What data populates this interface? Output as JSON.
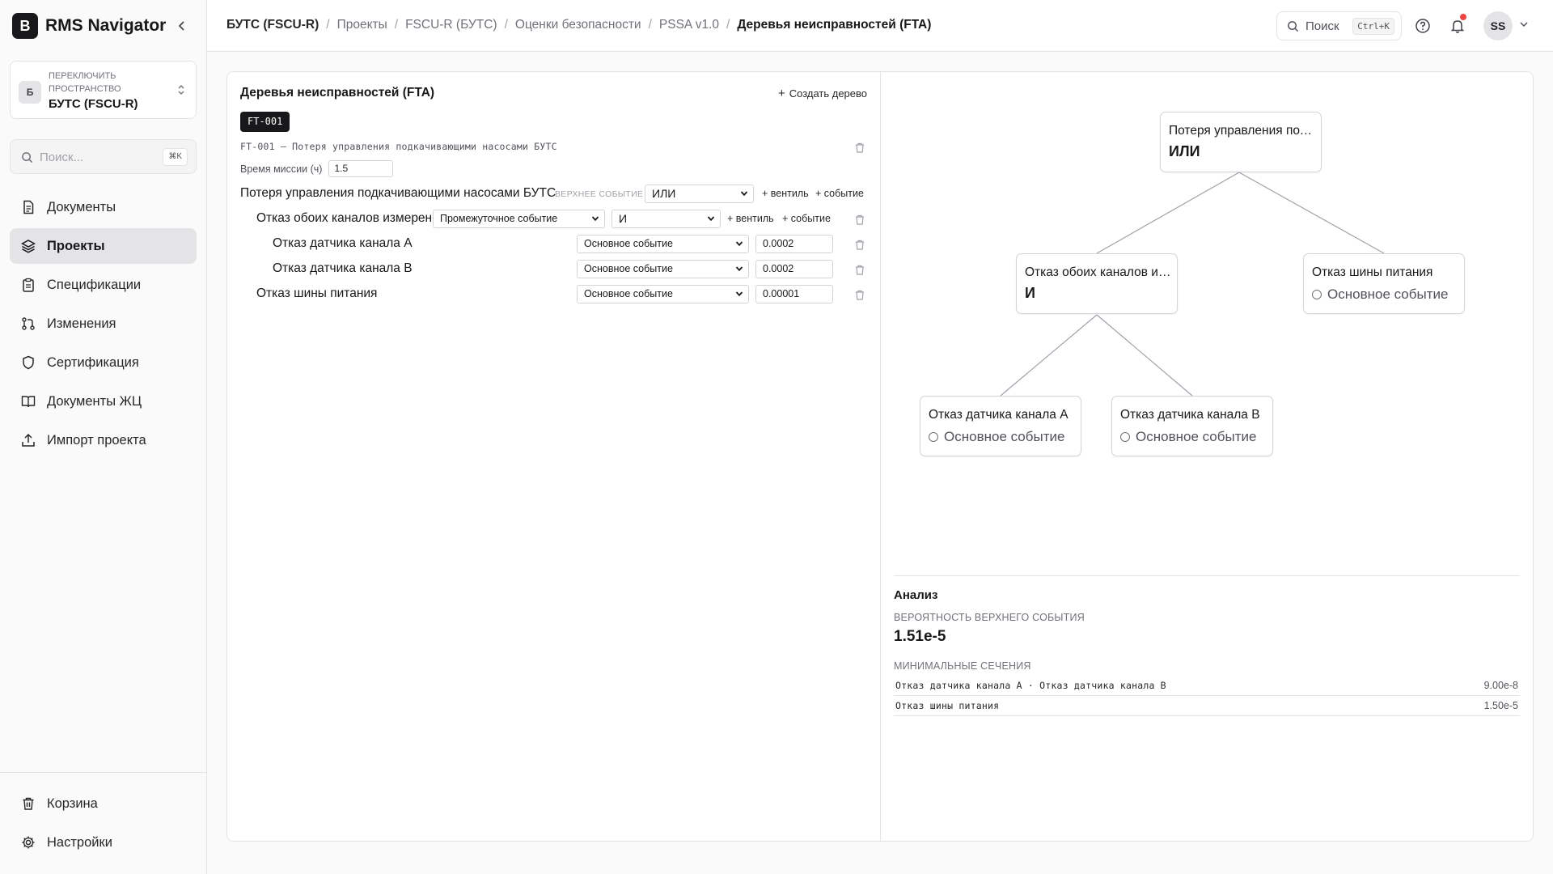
{
  "app": {
    "logo_letter": "B",
    "name": "RMS Navigator"
  },
  "workspace": {
    "switch_label": "Переключить пространство",
    "avatar_letter": "Б",
    "name": "БУТС (FSCU-R)"
  },
  "sidebar_search": {
    "placeholder": "Поиск...",
    "shortcut": "⌘K"
  },
  "nav": {
    "items": [
      {
        "label": "Документы",
        "icon": "file-text-icon"
      },
      {
        "label": "Проекты",
        "icon": "layers-icon",
        "active": true
      },
      {
        "label": "Спецификации",
        "icon": "clipboard-list-icon"
      },
      {
        "label": "Изменения",
        "icon": "git-pull-request-icon"
      },
      {
        "label": "Сертификация",
        "icon": "shield-icon"
      },
      {
        "label": "Документы ЖЦ",
        "icon": "book-open-icon"
      },
      {
        "label": "Импорт проекта",
        "icon": "upload-icon"
      }
    ],
    "bottom": [
      {
        "label": "Корзина",
        "icon": "trash-icon"
      },
      {
        "label": "Настройки",
        "icon": "gear-icon"
      }
    ]
  },
  "breadcrumbs": [
    "БУТС (FSCU-R)",
    "Проекты",
    "FSCU-R (БУТС)",
    "Оценки безопасности",
    "PSSA v1.0",
    "Деревья неисправностей (FTA)"
  ],
  "top_search": {
    "placeholder": "Поиск",
    "shortcut": "Ctrl+K"
  },
  "user": {
    "initials": "SS"
  },
  "fta": {
    "title": "Деревья неисправностей (FTA)",
    "create_label": "Создать дерево",
    "tree_tag": "FT-001",
    "tree_desc": "FT-001 — Потеря управления подкачивающими насосами БУТС",
    "mission_label": "Время миссии (ч)",
    "mission_value": "1.5",
    "add_gate": "+ вентиль",
    "add_event": "+ событие",
    "top": {
      "label": "Потеря управления подкачивающими насосами БУТС",
      "tag": "Верхнее событие",
      "gate": "ИЛИ"
    },
    "rows": [
      {
        "label": "Отказ обоих каналов измерения",
        "type": "Промежуточное событие",
        "gate": "И"
      },
      {
        "label": "Отказ датчика канала А",
        "type": "Основное событие",
        "value": "0.0002"
      },
      {
        "label": "Отказ датчика канала В",
        "type": "Основное событие",
        "value": "0.0002"
      },
      {
        "label": "Отказ шины питания",
        "type": "Основное событие",
        "value": "0.00001"
      }
    ]
  },
  "graph": {
    "nodes": [
      {
        "title": "Потеря управления подкачивающими насосами БУТС",
        "gate": "ИЛИ"
      },
      {
        "title": "Отказ обоих каналов измерения",
        "gate": "И"
      },
      {
        "title": "Отказ шины питания",
        "basic": "Основное событие"
      },
      {
        "title": "Отказ датчика канала А",
        "basic": "Основное событие"
      },
      {
        "title": "Отказ датчика канала В",
        "basic": "Основное событие"
      }
    ]
  },
  "analysis": {
    "title": "Анализ",
    "top_prob_label": "Вероятность верхнего события",
    "top_prob": "1.51e-5",
    "cutsets_label": "Минимальные сечения",
    "cutsets": [
      {
        "name": "Отказ датчика канала А · Отказ датчика канала В",
        "value": "9.00e-8"
      },
      {
        "name": "Отказ шины питания",
        "value": "1.50e-5"
      }
    ]
  }
}
